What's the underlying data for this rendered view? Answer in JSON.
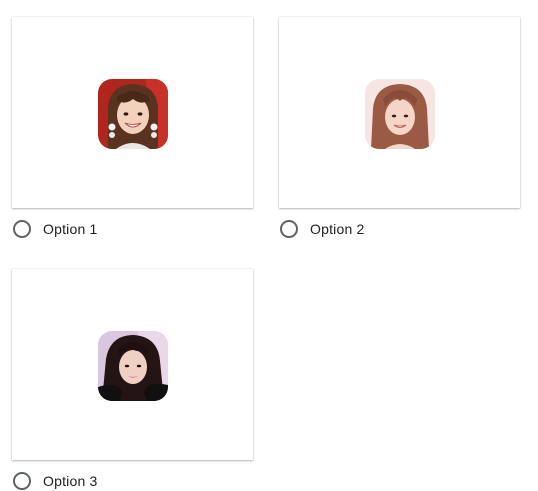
{
  "options": [
    {
      "label": "Option 1",
      "selected": false,
      "image": "portrait-photo"
    },
    {
      "label": "Option 2",
      "selected": false,
      "image": "portrait-photo"
    },
    {
      "label": "Option 3",
      "selected": false,
      "image": "portrait-photo"
    }
  ],
  "colors": {
    "radio_border": "#5f6368",
    "label_text": "#202124",
    "card_bg": "#ffffff"
  }
}
